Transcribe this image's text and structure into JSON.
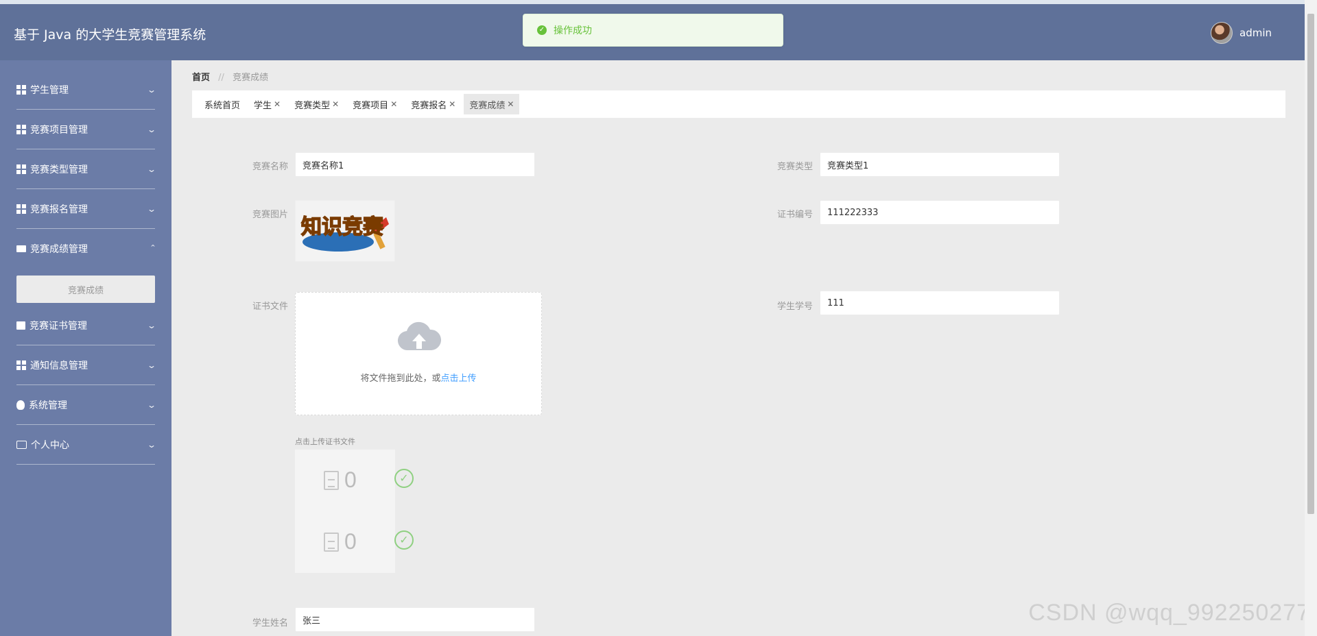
{
  "header": {
    "title": "基于 Java 的大学生竞赛管理系统",
    "username": "admin"
  },
  "toast": {
    "message": "操作成功"
  },
  "sidebar": {
    "items": [
      {
        "label": "学生管理",
        "icon": "grid-icon"
      },
      {
        "label": "竞赛项目管理",
        "icon": "grid-icon"
      },
      {
        "label": "竞赛类型管理",
        "icon": "grid-icon"
      },
      {
        "label": "竞赛报名管理",
        "icon": "grid-icon"
      },
      {
        "label": "竞赛成绩管理",
        "icon": "chat-icon",
        "expanded": true,
        "sub": [
          "竞赛成绩"
        ]
      },
      {
        "label": "竞赛证书管理",
        "icon": "doc-icon"
      },
      {
        "label": "通知信息管理",
        "icon": "grid-icon"
      },
      {
        "label": "系统管理",
        "icon": "bulb-icon"
      },
      {
        "label": "个人中心",
        "icon": "card-icon"
      }
    ]
  },
  "breadcrumb": {
    "home": "首页",
    "separator": "//",
    "current": "竞赛成绩"
  },
  "tabs": [
    {
      "label": "系统首页",
      "closable": false
    },
    {
      "label": "学生",
      "closable": true
    },
    {
      "label": "竞赛类型",
      "closable": true
    },
    {
      "label": "竞赛项目",
      "closable": true
    },
    {
      "label": "竞赛报名",
      "closable": true
    },
    {
      "label": "竞赛成绩",
      "closable": true,
      "active": true
    }
  ],
  "form": {
    "name_label": "竞赛名称",
    "name_value": "竞赛名称1",
    "type_label": "竞赛类型",
    "type_value": "竞赛类型1",
    "picture_label": "竞赛图片",
    "cert_no_label": "证书编号",
    "cert_no_value": "111222333",
    "cert_file_label": "证书文件",
    "student_no_label": "学生学号",
    "student_no_value": "111",
    "upload_text": "将文件拖到此处，或",
    "upload_link": "点击上传",
    "upload_hint": "点击上传证书文件",
    "file_counts": [
      "0",
      "0"
    ],
    "student_name_label": "学生姓名",
    "student_name_value": "张三"
  },
  "image_text": "知识竞赛",
  "watermark": "CSDN @wqq_992250277",
  "colors": {
    "header": "#5f7199",
    "sidebar": "#6b7ca7",
    "success": "#67c23a",
    "link": "#409eff"
  }
}
